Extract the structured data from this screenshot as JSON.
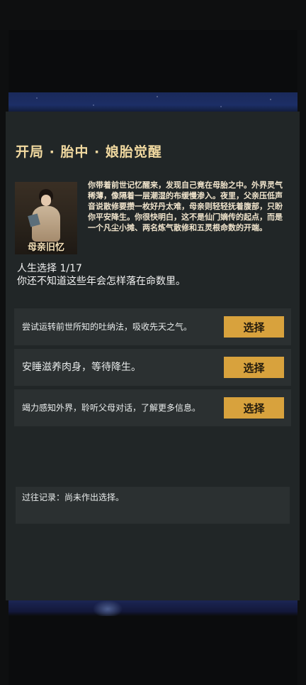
{
  "event": {
    "title": "开局 · 胎中 · 娘胎觉醒",
    "portrait_caption": "母亲旧忆",
    "story": "你带着前世记忆醒来，发现自己竟在母胎之中。外界灵气稀薄，像隔着一层潮湿的布缓慢渗入。夜里，父亲压低声音说散修要攒一枚好丹太难，母亲则轻轻抚着腹部，只盼你平安降生。你很快明白，这不是仙门嫡传的起点，而是一个凡尘小摊、两名炼气散修和五灵根命数的开端。",
    "progress": "人生选择 1/17",
    "question": "你还不知道这些年会怎样落在命数里。"
  },
  "choices": [
    {
      "text": "尝试运转前世所知的吐纳法，吸收先天之气。",
      "button": "选择"
    },
    {
      "text": "安睡滋养肉身，等待降生。",
      "button": "选择"
    },
    {
      "text": "竭力感知外界，聆听父母对话，了解更多信息。",
      "button": "选择"
    }
  ],
  "history": {
    "text": "过往记录：尚未作出选择。"
  },
  "colors": {
    "accent": "#d8a23d",
    "title": "#f1d9a0",
    "panel": "#212627",
    "card": "#2b3031"
  }
}
